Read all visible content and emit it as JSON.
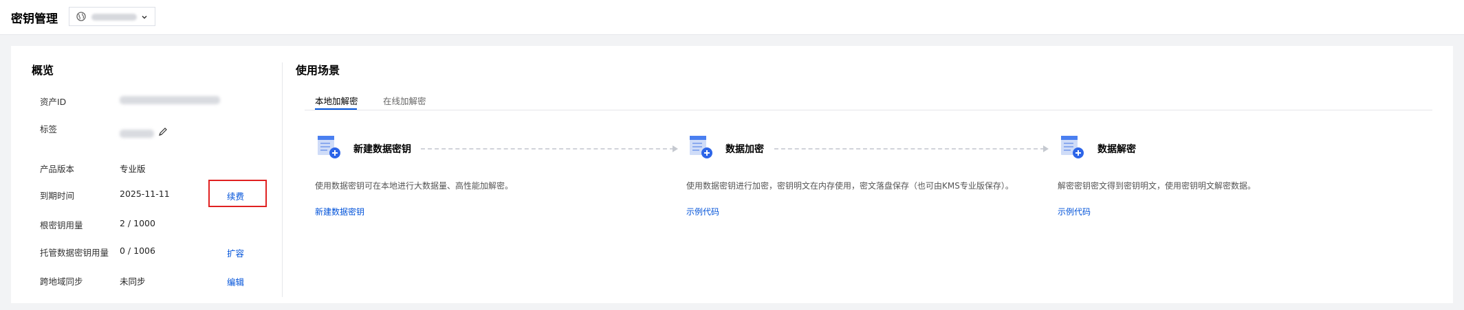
{
  "header": {
    "title": "密钥管理",
    "region_icon": "globe-icon",
    "region_chevron_icon": "chevron-down-icon"
  },
  "overview": {
    "title": "概览",
    "rows": [
      {
        "label": "资产ID"
      },
      {
        "label": "标签",
        "edit_icon": "pencil-icon"
      },
      {
        "label": "产品版本",
        "value": "专业版"
      },
      {
        "label": "到期时间",
        "value": "2025-11-11",
        "action": "续费"
      },
      {
        "label": "根密钥用量",
        "value": "2 / 1000"
      },
      {
        "label": "托管数据密钥用量",
        "value": "0 / 1006",
        "action": "扩容"
      },
      {
        "label": "跨地域同步",
        "value": "未同步",
        "action": "编辑"
      }
    ]
  },
  "scenarios": {
    "title": "使用场景",
    "tabs": [
      {
        "label": "本地加解密",
        "active": true
      },
      {
        "label": "在线加解密",
        "active": false
      }
    ],
    "steps": [
      {
        "icon": "document-add-icon",
        "title": "新建数据密钥",
        "desc": "使用数据密钥可在本地进行大数据量、高性能加解密。",
        "link": "新建数据密钥"
      },
      {
        "icon": "document-add-icon",
        "title": "数据加密",
        "desc": "使用数据密钥进行加密，密钥明文在内存使用，密文落盘保存（也可由KMS专业版保存）。",
        "link": "示例代码"
      },
      {
        "icon": "document-add-icon",
        "title": "数据解密",
        "desc": "解密密钥密文得到密钥明文，使用密钥明文解密数据。",
        "link": "示例代码"
      }
    ]
  },
  "colors": {
    "accent": "#0052d9",
    "highlight_box": "#e02020",
    "icon_blue": "#4a7ff0",
    "icon_light": "#cfdcf8"
  }
}
